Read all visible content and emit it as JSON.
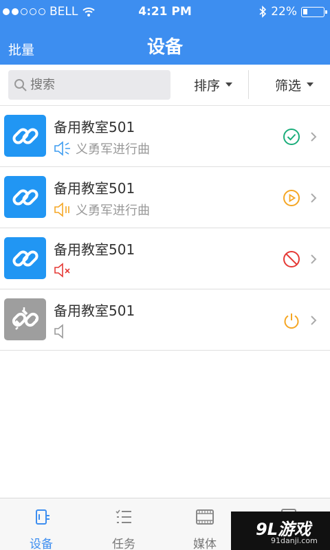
{
  "status_bar": {
    "carrier": "BELL",
    "time": "4:21 PM",
    "battery": "22%",
    "battery_level": 0.22
  },
  "nav": {
    "left_label": "批量",
    "title": "设备"
  },
  "toolbar": {
    "search": {
      "placeholder": "搜索"
    },
    "sort_label": "排序",
    "filter_label": "筛选"
  },
  "devices": [
    {
      "name": "备用教室501",
      "track": "义勇军进行曲",
      "speaker": "speaker-playing-icon",
      "status": "check-circle-icon",
      "status_color": "#1aad7a",
      "thumb": "link-icon"
    },
    {
      "name": "备用教室501",
      "track": "义勇军进行曲",
      "speaker": "speaker-paused-icon",
      "status": "play-circle-icon",
      "status_color": "#f5a623",
      "thumb": "link-icon"
    },
    {
      "name": "备用教室501",
      "track": "",
      "speaker": "speaker-muted-icon",
      "status": "blocked-icon",
      "status_color": "#e53935",
      "thumb": "link-icon"
    },
    {
      "name": "备用教室501",
      "track": "",
      "speaker": "speaker-idle-icon",
      "status": "power-icon",
      "status_color": "#f5a623",
      "thumb": "broken-link-icon"
    }
  ],
  "tabs": [
    {
      "label": "设备",
      "icon": "device-icon",
      "active": true
    },
    {
      "label": "任务",
      "icon": "task-list-icon",
      "active": false
    },
    {
      "label": "媒体",
      "icon": "media-film-icon",
      "active": false
    },
    {
      "label": "",
      "icon": "settings-icon",
      "active": false
    }
  ],
  "watermark": {
    "brand": "9L游戏",
    "domain": "91danji.com"
  },
  "colors": {
    "accent": "#3d8ef0",
    "thumb_blue": "#2196f3",
    "thumb_gray": "#9e9e9e"
  }
}
